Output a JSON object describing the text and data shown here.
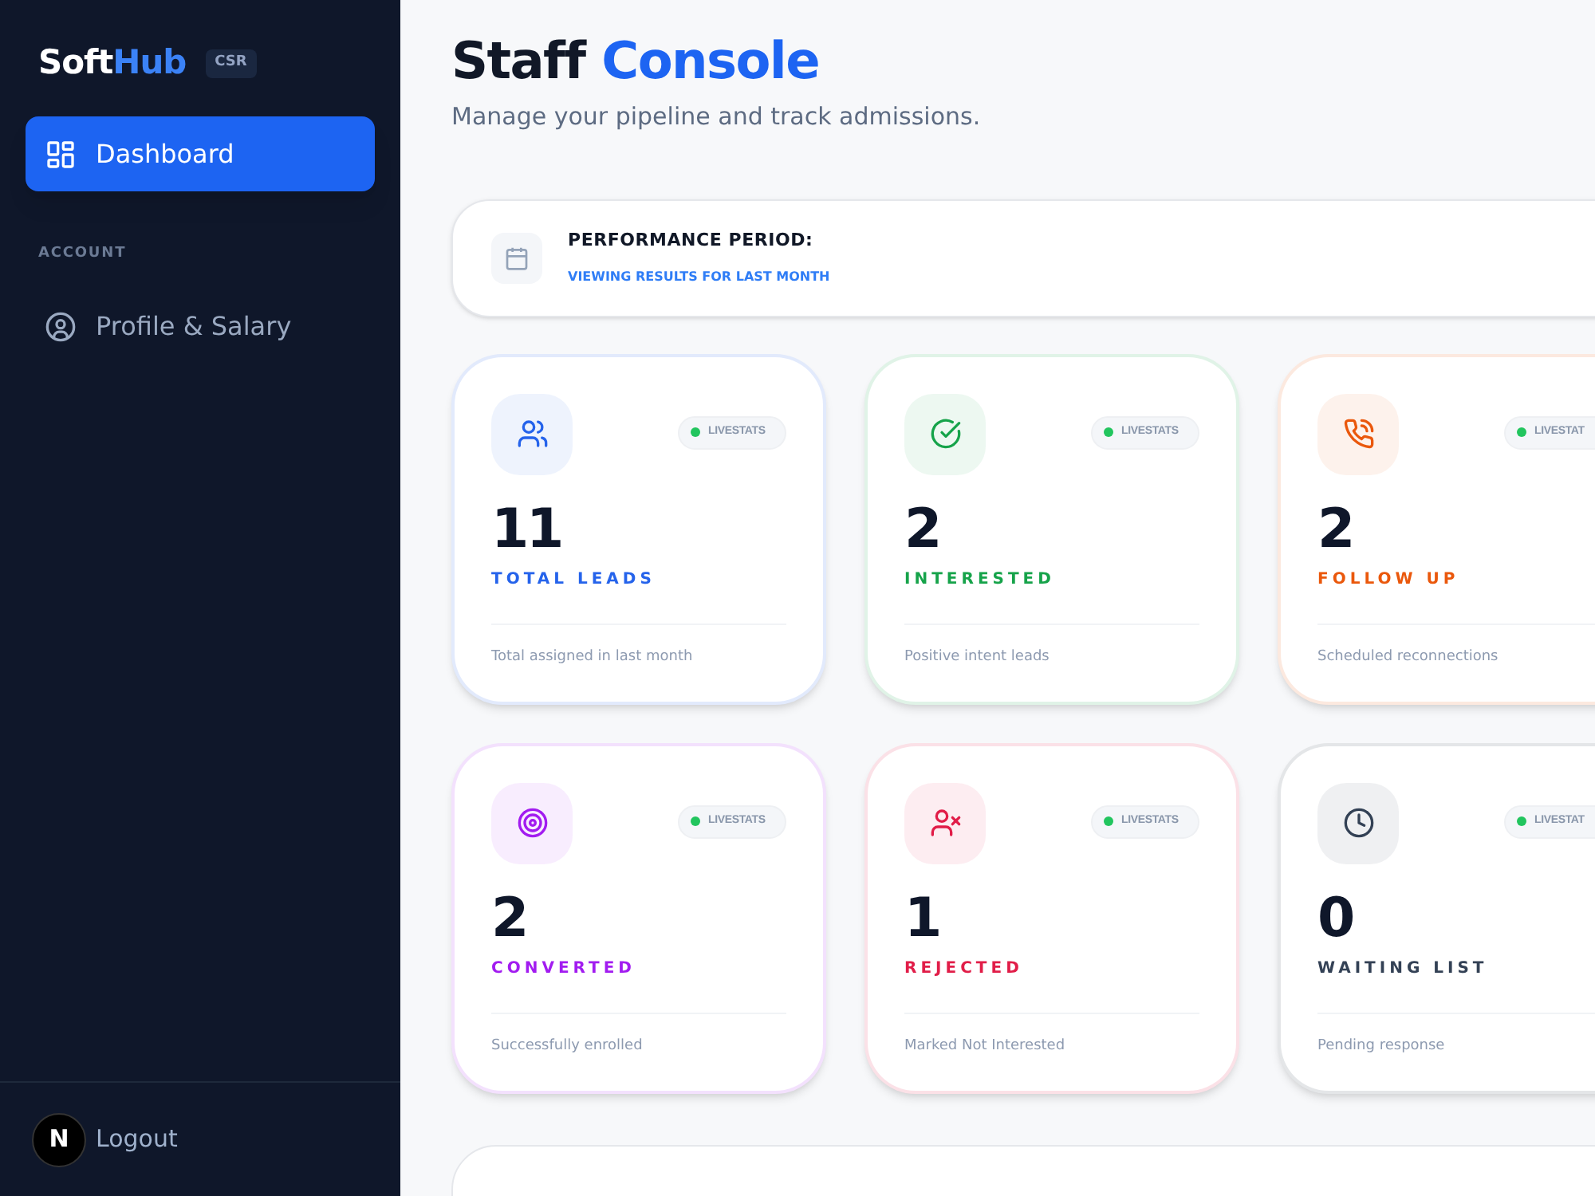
{
  "sidebar": {
    "brand": {
      "part_1": "Soft",
      "part_2": "Hub",
      "badge": "CSR"
    },
    "items": [
      {
        "kind": "grid",
        "label": "Dashboard",
        "selected": true
      }
    ],
    "section_label": "ACCOUNT",
    "account_items": [
      {
        "kind": "user",
        "label": "Profile & Salary",
        "selected": false
      }
    ],
    "footer": {
      "avatar": "N",
      "label": "Logout"
    }
  },
  "header": {
    "title_1": "Staff",
    "title_2": "Console",
    "subtitle": "Manage your pipeline and track admissions."
  },
  "period": {
    "title": "PERFORMANCE PERIOD:",
    "detail": "VIEWING RESULTS FOR LAST MONTH"
  },
  "cards": [
    {
      "kind": "users",
      "value": "11",
      "label": "TOTAL LEADS",
      "description": "Total assigned in last month",
      "badge": "LIVESTATS",
      "color": "#2563eb"
    },
    {
      "kind": "check",
      "value": "2",
      "label": "INTERESTED",
      "description": "Positive intent leads",
      "badge": "LIVESTATS",
      "color": "#16a34a"
    },
    {
      "kind": "phone",
      "value": "2",
      "label": "FOLLOW UP",
      "description": "Scheduled reconnections",
      "badge": "LIVESTAT",
      "color": "#ea580c"
    },
    {
      "kind": "target",
      "value": "2",
      "label": "CONVERTED",
      "description": "Successfully enrolled",
      "badge": "LIVESTATS",
      "color": "#a21cf0"
    },
    {
      "kind": "user-x",
      "value": "1",
      "label": "REJECTED",
      "description": "Marked Not Interested",
      "badge": "LIVESTATS",
      "color": "#e11d48"
    },
    {
      "kind": "clock",
      "value": "0",
      "label": "WAITING LIST",
      "description": "Pending response",
      "badge": "LIVESTAT",
      "color": "#334155"
    }
  ]
}
